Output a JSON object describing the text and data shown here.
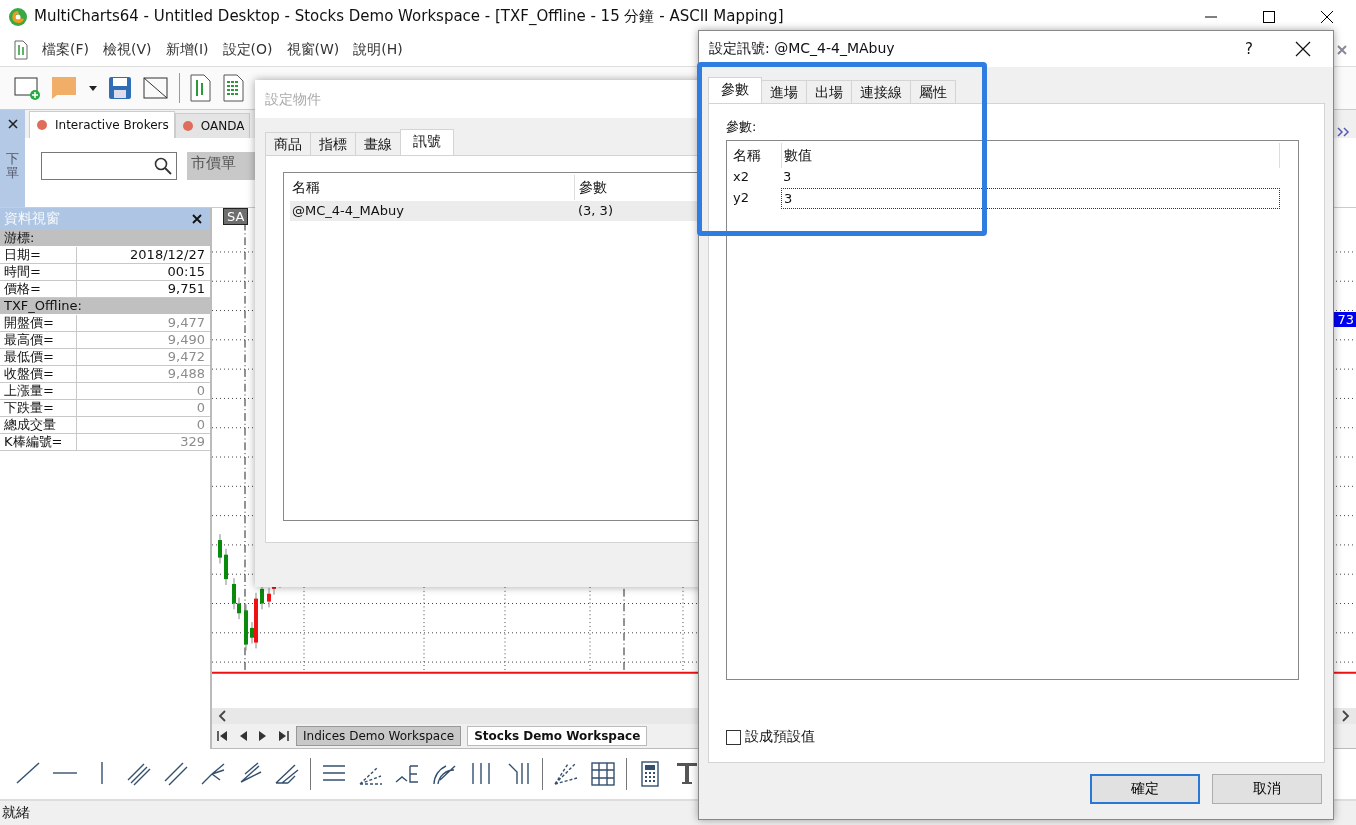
{
  "window": {
    "title": "MultiCharts64 - Untitled Desktop - Stocks Demo Workspace - [TXF_Offline - 15 分鐘 - ASCII Mapping]"
  },
  "menu": [
    "檔案(F)",
    "檢視(V)",
    "新增(I)",
    "設定(O)",
    "視窗(W)",
    "說明(H)"
  ],
  "order_panel": {
    "side_label": "下單",
    "tabs": [
      {
        "label": "Interactive Brokers",
        "selected": true
      },
      {
        "label": "OANDA",
        "selected": false
      }
    ],
    "order_type": "市價單"
  },
  "data_window": {
    "title": "資料視窗",
    "sections": [
      {
        "heading": "游標:",
        "rows": [
          {
            "label": "日期=",
            "value": "2018/12/27",
            "dimmed": false
          },
          {
            "label": "時間=",
            "value": "00:15",
            "dimmed": false
          },
          {
            "label": "價格=",
            "value": "9,751",
            "dimmed": false
          }
        ]
      },
      {
        "heading": "TXF_Offline:",
        "rows": [
          {
            "label": "開盤價=",
            "value": "9,477",
            "dimmed": true
          },
          {
            "label": "最高價=",
            "value": "9,490",
            "dimmed": true
          },
          {
            "label": "最低價=",
            "value": "9,472",
            "dimmed": true
          },
          {
            "label": "收盤價=",
            "value": "9,488",
            "dimmed": true
          },
          {
            "label": "上漲量=",
            "value": "0",
            "dimmed": true
          },
          {
            "label": "下跌量=",
            "value": "0",
            "dimmed": true
          },
          {
            "label": "總成交量",
            "value": "0",
            "dimmed": true
          },
          {
            "label": "K棒編號=",
            "value": "329",
            "dimmed": true
          }
        ]
      }
    ]
  },
  "chart": {
    "symbol_tag": "SA",
    "price_tag": "73",
    "sheets": [
      {
        "label": "Indices Demo Workspace",
        "selected": false
      },
      {
        "label": "Stocks Demo Workspace",
        "selected": true
      }
    ]
  },
  "status_bar": "就緒",
  "object_dialog": {
    "title": "設定物件",
    "tabs": [
      {
        "label": "商品",
        "selected": false
      },
      {
        "label": "指標",
        "selected": false
      },
      {
        "label": "畫線",
        "selected": false
      },
      {
        "label": "訊號",
        "selected": true
      }
    ],
    "columns": [
      "名稱",
      "參數"
    ],
    "rows": [
      {
        "name": "@MC_4-4_MAbuy",
        "params": "(3, 3)",
        "selected": true
      }
    ]
  },
  "signal_dialog": {
    "title": "設定訊號: @MC_4-4_MAbuy",
    "help": "?",
    "tabs": [
      {
        "label": "參數",
        "selected": true
      },
      {
        "label": "進場",
        "selected": false
      },
      {
        "label": "出場",
        "selected": false
      },
      {
        "label": "連接線",
        "selected": false
      },
      {
        "label": "屬性",
        "selected": false
      }
    ],
    "section_label": "參數:",
    "columns": [
      "名稱",
      "數值"
    ],
    "rows": [
      {
        "name": "x2",
        "value": "3",
        "editing": false
      },
      {
        "name": "y2",
        "value": "3",
        "editing": true
      }
    ],
    "default_checkbox": {
      "label": "設成預設值",
      "checked": false
    },
    "buttons": [
      {
        "label": "確定",
        "default": true
      },
      {
        "label": "取消",
        "default": false
      }
    ],
    "highlight": true
  }
}
